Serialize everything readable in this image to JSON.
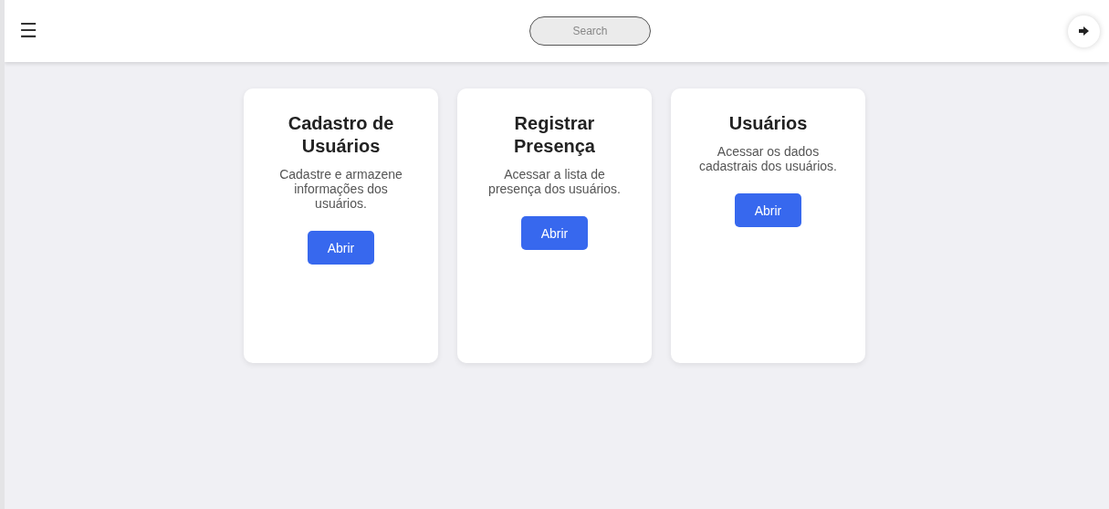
{
  "header": {
    "menu_icon": "☰",
    "search": {
      "placeholder": "Search"
    }
  },
  "cards": [
    {
      "title": "Cadastro de Usuários",
      "description": "Cadastre e armazene informações dos usuários.",
      "button": "Abrir"
    },
    {
      "title": "Registrar Presença",
      "description": "Acessar a lista de presença dos usuários.",
      "button": "Abrir"
    },
    {
      "title": "Usuários",
      "description": "Acessar os dados cadastrais dos usuários.",
      "button": "Abrir"
    }
  ]
}
